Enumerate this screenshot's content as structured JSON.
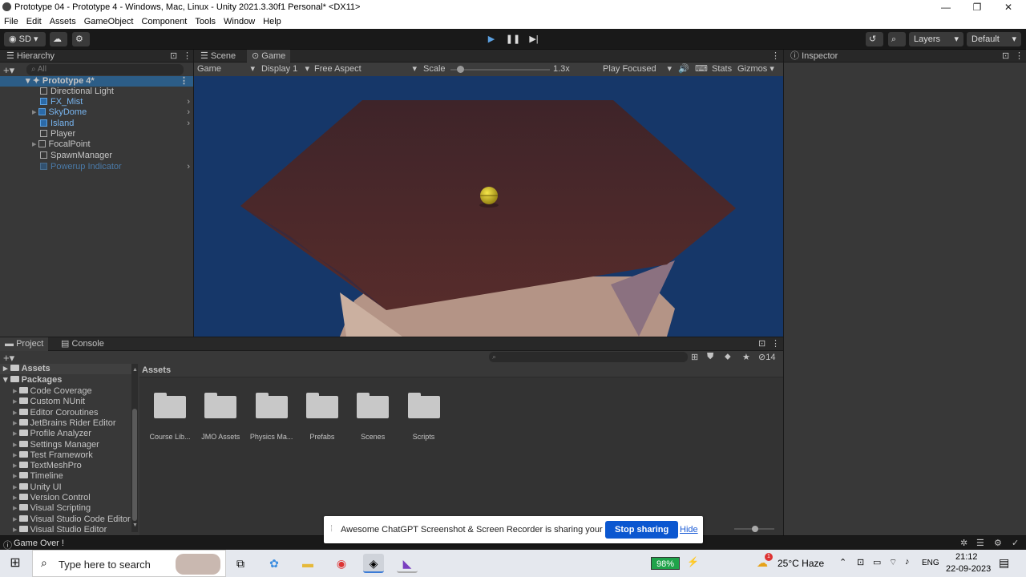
{
  "window": {
    "title": "Prototype 04 - Prototype 4 - Windows, Mac, Linux - Unity 2021.3.30f1 Personal* <DX11>",
    "minimize": "—",
    "maximize": "❐",
    "close": "✕"
  },
  "menu": [
    "File",
    "Edit",
    "Assets",
    "GameObject",
    "Component",
    "Tools",
    "Window",
    "Help"
  ],
  "toolbar": {
    "account": "SD",
    "layers": "Layers",
    "layout": "Default"
  },
  "hierarchy": {
    "tab": "Hierarchy",
    "search_placeholder": "All",
    "scene": "Prototype 4*",
    "items": [
      {
        "label": "Directional Light"
      },
      {
        "label": "FX_Mist"
      },
      {
        "label": "SkyDome"
      },
      {
        "label": "Island"
      },
      {
        "label": "Player"
      },
      {
        "label": "FocalPoint"
      },
      {
        "label": "SpawnManager"
      },
      {
        "label": "Powerup Indicator"
      }
    ]
  },
  "game": {
    "tabs": [
      "Scene",
      "Game"
    ],
    "display_mode": "Game",
    "display": "Display 1",
    "aspect": "Free Aspect",
    "scale_label": "Scale",
    "scale_value": 0.1,
    "scale_text": "1.3x",
    "play_mode": "Play Focused",
    "stats": "Stats",
    "gizmos": "Gizmos"
  },
  "inspector": {
    "tab": "Inspector"
  },
  "project": {
    "tabs": [
      "Project",
      "Console"
    ],
    "count": "14",
    "breadcrumb": "Assets",
    "tree_roots": [
      "Assets",
      "Packages"
    ],
    "packages": [
      "Code Coverage",
      "Custom NUnit",
      "Editor Coroutines",
      "JetBrains Rider Editor",
      "Profile Analyzer",
      "Settings Manager",
      "Test Framework",
      "TextMeshPro",
      "Timeline",
      "Unity UI",
      "Version Control",
      "Visual Scripting",
      "Visual Studio Code Editor",
      "Visual Studio Editor"
    ],
    "folders": [
      "Course Lib...",
      "JMO Assets",
      "Physics Ma...",
      "Prefabs",
      "Scenes",
      "Scripts"
    ]
  },
  "status": {
    "message": "Game Over !"
  },
  "share": {
    "message": "Awesome ChatGPT Screenshot & Screen Recorder is sharing your screen.",
    "stop": "Stop sharing",
    "hide": "Hide"
  },
  "taskbar": {
    "search_placeholder": "Type here to search",
    "battery": "98%",
    "weather": "25°C  Haze",
    "lang": "ENG",
    "time": "21:12",
    "date": "22-09-2023",
    "weather_badge": "1"
  },
  "colors": {
    "accent": "#0078d4",
    "game_bg": "#163769",
    "platform": "#4a2a2c"
  }
}
